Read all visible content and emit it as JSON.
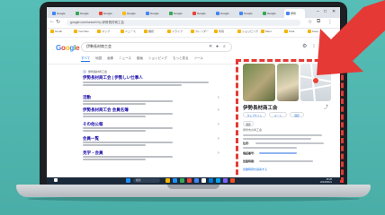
{
  "browser": {
    "tabs": [
      {
        "label": "Google",
        "color": "#4285f4",
        "active": false
      },
      {
        "label": "Google",
        "color": "#34a853",
        "active": false
      },
      {
        "label": "Google",
        "color": "#ea4335",
        "active": false
      },
      {
        "label": "Google",
        "color": "#fbbc05",
        "active": false
      },
      {
        "label": "Google",
        "color": "#4285f4",
        "active": false
      },
      {
        "label": "Google",
        "color": "#34a853",
        "active": false
      },
      {
        "label": "Google",
        "color": "#ea4335",
        "active": false
      },
      {
        "label": "Google",
        "color": "#4285f4",
        "active": false
      },
      {
        "label": "Google",
        "color": "#4285f4",
        "active": false
      },
      {
        "label": "Google",
        "color": "#34a853",
        "active": false
      },
      {
        "label": "伊勢",
        "color": "#4285f4",
        "active": true
      }
    ],
    "url": "google.com/search?q=伊勢長材商工会",
    "bookmarks": [
      "Gmail",
      "YouTube",
      "マップ",
      "ニュース",
      "翻訳",
      "ドライブ",
      "カレンダー",
      "写真",
      "ショッピング",
      "Meet",
      "Chat",
      "Keep"
    ]
  },
  "google": {
    "logo": "Google",
    "query": "伊勢長材商工会",
    "filters": [
      "すべて",
      "地図",
      "画像",
      "ニュース",
      "動画",
      "ショッピング",
      "もっと見る",
      "ツール"
    ]
  },
  "results": [
    {
      "site": "伊勢長材商工会",
      "title": "伊勢長材商工会 | 伊勢しい仕事人"
    },
    {
      "site": "",
      "title": "活動"
    },
    {
      "site": "",
      "title": "伊勢長材商工会 会員名簿"
    },
    {
      "site": "",
      "title": "その他公報"
    },
    {
      "site": "",
      "title": "会員一覧"
    },
    {
      "site": "",
      "title": "見学・会員"
    }
  ],
  "knowledge_panel": {
    "title": "伊勢長材商工会",
    "buttons": [
      "ウェブサイト",
      "ルート",
      "保存"
    ],
    "chip": "保存",
    "subtitle": "伊勢市の商工会",
    "labels": [
      "住所:",
      "電話番号:",
      "営業時間:"
    ],
    "link": "営業時間を提案する"
  },
  "taskbar": {
    "search_placeholder": "検索",
    "time": "15:28",
    "date": "2023/09/21"
  },
  "colors": {
    "background": "#4fb7b0",
    "highlight": "#e53935",
    "link": "#1a0dab",
    "accent": "#1a73e8"
  }
}
